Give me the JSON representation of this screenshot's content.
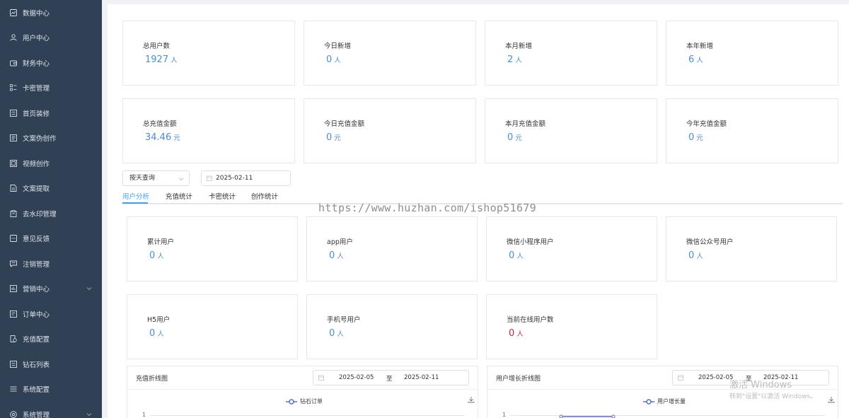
{
  "sidebar": {
    "items": [
      {
        "label": "数据中心",
        "icon": "chart-icon",
        "chevron": false
      },
      {
        "label": "用户中心",
        "icon": "user-icon",
        "chevron": false
      },
      {
        "label": "财务中心",
        "icon": "wallet-icon",
        "chevron": false
      },
      {
        "label": "卡密管理",
        "icon": "list-icon",
        "chevron": false
      },
      {
        "label": "首页装修",
        "icon": "brush-icon",
        "chevron": false
      },
      {
        "label": "文案伪创作",
        "icon": "document-icon",
        "chevron": false
      },
      {
        "label": "视频创作",
        "icon": "video-icon",
        "chevron": false
      },
      {
        "label": "文案提取",
        "icon": "extract-icon",
        "chevron": false
      },
      {
        "label": "去水印管理",
        "icon": "clipboard-icon",
        "chevron": false
      },
      {
        "label": "意见反馈",
        "icon": "feedback-icon",
        "chevron": false
      },
      {
        "label": "注销管理",
        "icon": "message-icon",
        "chevron": false
      },
      {
        "label": "营销中心",
        "icon": "marketing-icon",
        "chevron": true
      },
      {
        "label": "订单中心",
        "icon": "order-icon",
        "chevron": false
      },
      {
        "label": "充值配置",
        "icon": "recharge-icon",
        "chevron": false
      },
      {
        "label": "钻石列表",
        "icon": "diamond-icon",
        "chevron": false
      },
      {
        "label": "系统配置",
        "icon": "menu-icon",
        "chevron": false
      },
      {
        "label": "系统管理",
        "icon": "settings-icon",
        "chevron": true
      }
    ]
  },
  "stats_row1": [
    {
      "label": "总用户数",
      "value": "1927",
      "unit": "人"
    },
    {
      "label": "今日新增",
      "value": "0",
      "unit": "人"
    },
    {
      "label": "本月新增",
      "value": "2",
      "unit": "人"
    },
    {
      "label": "本年新增",
      "value": "6",
      "unit": "人"
    }
  ],
  "stats_row2": [
    {
      "label": "总充值金额",
      "value": "34.46",
      "unit": "元"
    },
    {
      "label": "今日充值金额",
      "value": "0",
      "unit": "元"
    },
    {
      "label": "本月充值金额",
      "value": "0",
      "unit": "元"
    },
    {
      "label": "今年充值金额",
      "value": "0",
      "unit": "元"
    }
  ],
  "filter": {
    "query_mode": "按天查询",
    "date": "2025-02-11"
  },
  "tabs": [
    {
      "label": "用户分析",
      "active": true
    },
    {
      "label": "充值统计",
      "active": false
    },
    {
      "label": "卡密统计",
      "active": false
    },
    {
      "label": "创作统计",
      "active": false
    }
  ],
  "watermark": "https://www.huzhan.com/ishop51679",
  "user_stats_row1": [
    {
      "label": "累计用户",
      "value": "0",
      "unit": "人"
    },
    {
      "label": "app用户",
      "value": "0",
      "unit": "人"
    },
    {
      "label": "微信小程序用户",
      "value": "0",
      "unit": "人"
    },
    {
      "label": "微信公众号用户",
      "value": "0",
      "unit": "人"
    }
  ],
  "user_stats_row2": [
    {
      "label": "H5用户",
      "value": "0",
      "unit": "人"
    },
    {
      "label": "手机号用户",
      "value": "0",
      "unit": "人"
    },
    {
      "label": "当前在线用户数",
      "value": "0",
      "unit": "人",
      "color": "#c0292a"
    }
  ],
  "charts": [
    {
      "title": "充值折线图",
      "start": "2025-02-05",
      "sep": "至",
      "end": "2025-02-11",
      "legend": "钻石订单",
      "y_tick": "1"
    },
    {
      "title": "用户增长折线图",
      "start": "2025-02-05",
      "sep": "至",
      "end": "2025-02-11",
      "legend": "用户增长量",
      "y_tick": "1"
    }
  ],
  "windows": {
    "line1": "激活 Windows",
    "line2": "转到\"设置\"以激活 Windows。"
  },
  "colors": {
    "sidebar_bg": "#304156",
    "accent": "#409eff",
    "value_blue": "#4a8fd6",
    "value_red": "#c0292a"
  }
}
